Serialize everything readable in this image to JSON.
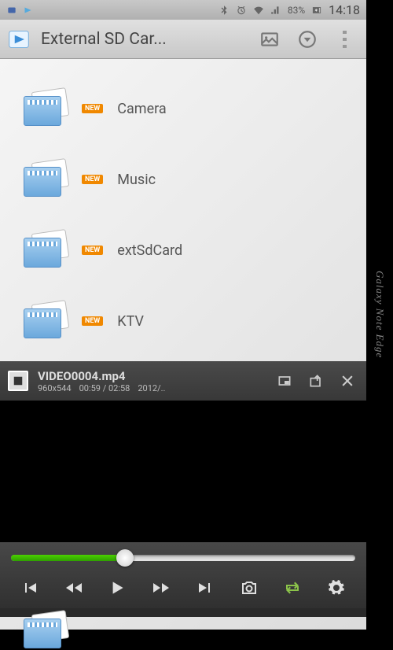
{
  "status": {
    "battery_text": "83%",
    "time": "14:18"
  },
  "titlebar": {
    "title": "External SD Car..."
  },
  "folders": [
    {
      "badge": "NEW",
      "name": "Camera"
    },
    {
      "badge": "NEW",
      "name": "Music"
    },
    {
      "badge": "NEW",
      "name": "extSdCard"
    },
    {
      "badge": "NEW",
      "name": "KTV"
    }
  ],
  "video": {
    "filename": "VIDEO0004.mp4",
    "resolution": "960x544",
    "elapsed": "00:59",
    "duration": "02:58",
    "time_sep": " / ",
    "date": "2012/..",
    "progress_pct": 33
  },
  "edge": {
    "label": "Galaxy Note Edge"
  }
}
